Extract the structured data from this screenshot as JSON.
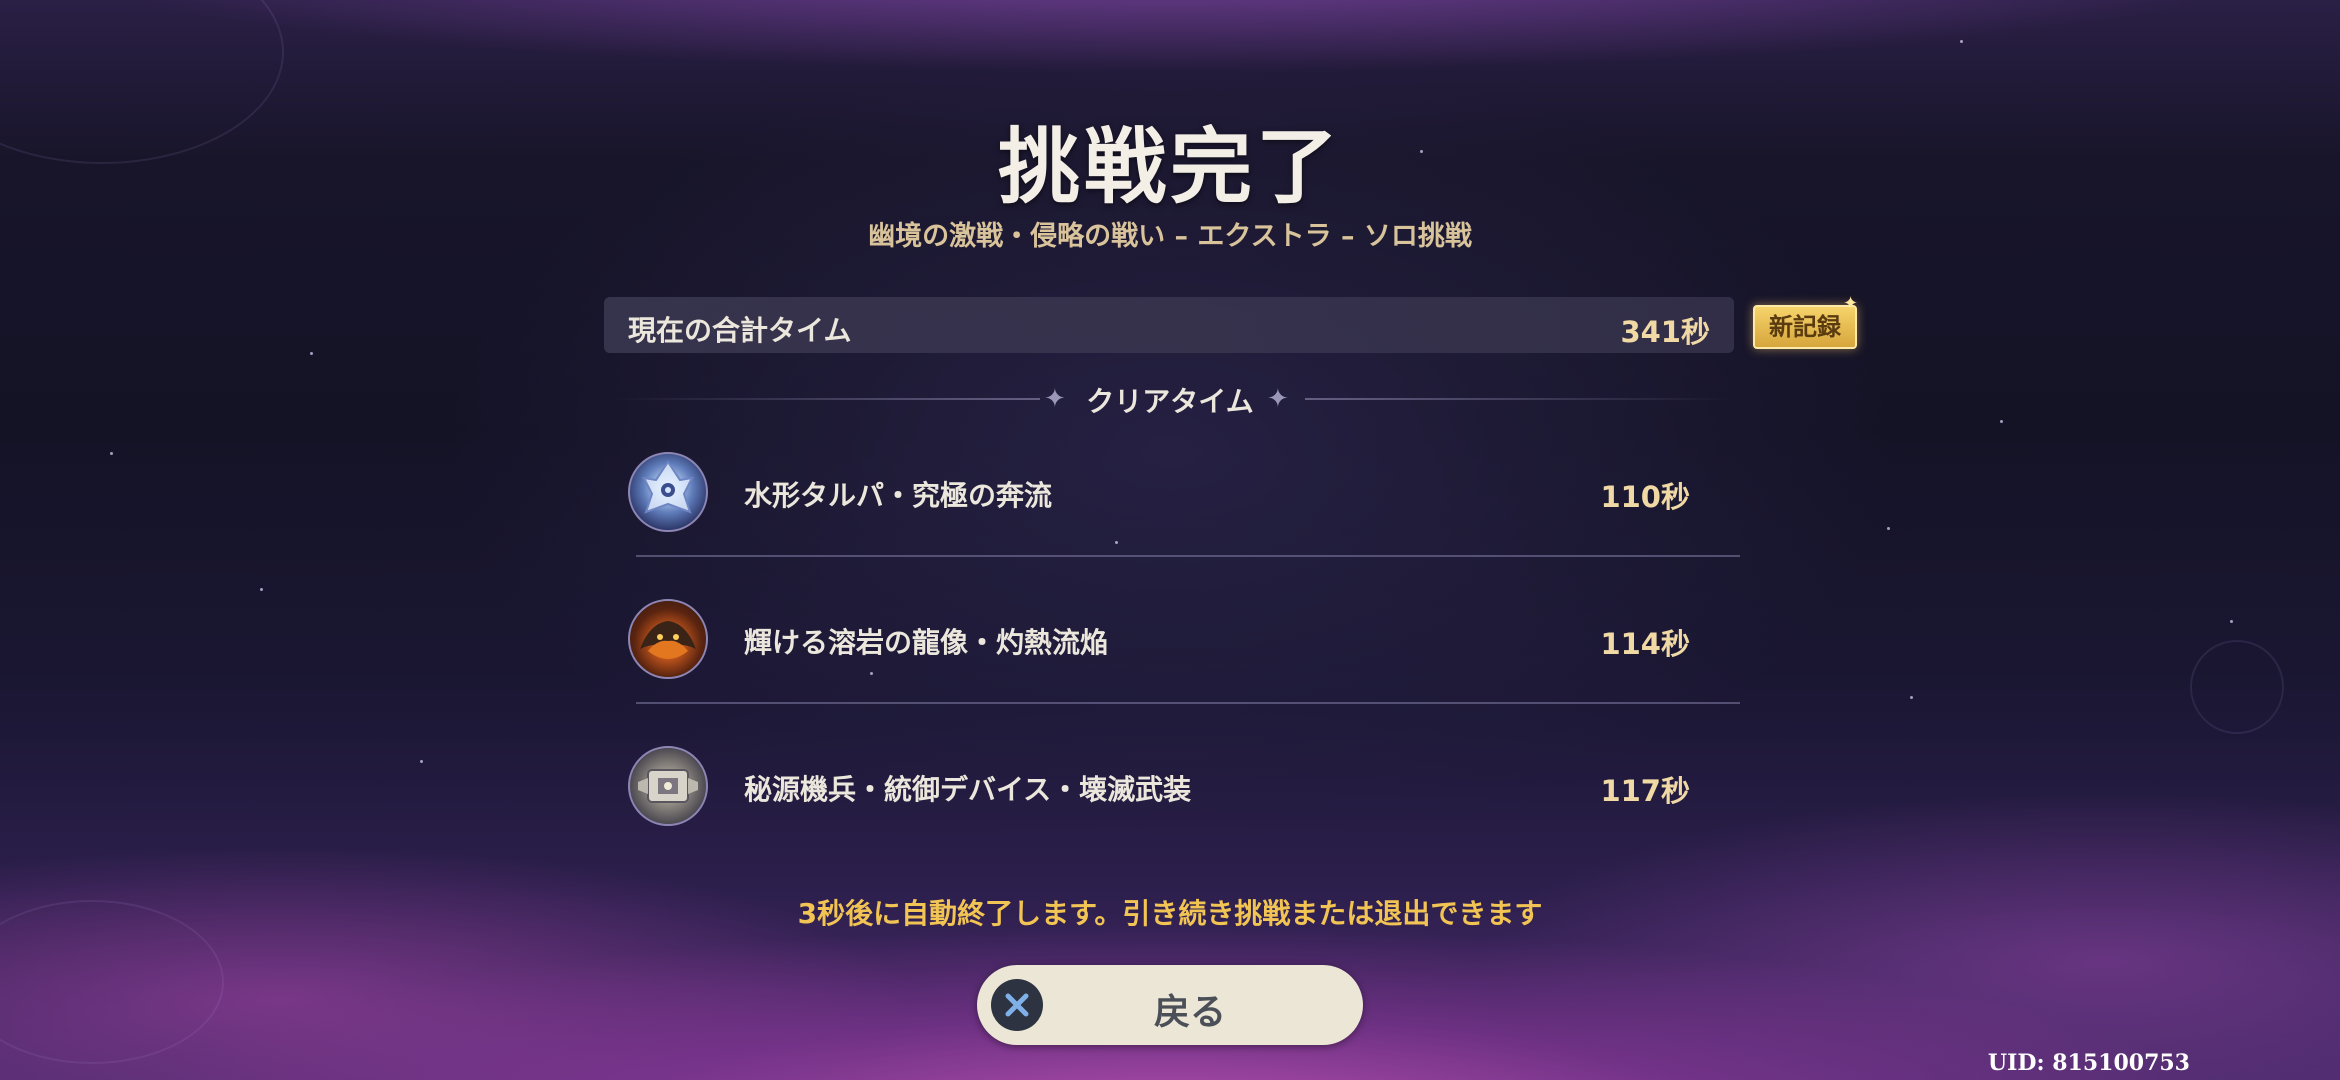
{
  "header": {
    "title": "挑戦完了",
    "subtitle": "幽境の激戦・侵略の戦い – エクストラ – ソロ挑戦"
  },
  "total": {
    "label": "現在の合計タイム",
    "value": "341秒",
    "badge": "新記録"
  },
  "section": {
    "label": "クリアタイム"
  },
  "bosses": [
    {
      "name": "水形タルパ・究極の奔流",
      "time": "110秒",
      "icon": "hydro-tulpa-portrait"
    },
    {
      "name": "輝ける溶岩の龍像・灼熱流焔",
      "time": "114秒",
      "icon": "lava-dragon-statue-portrait"
    },
    {
      "name": "秘源機兵・統御デバイス・壊滅武装",
      "time": "117秒",
      "icon": "secret-source-automaton-portrait"
    }
  ],
  "notice": "3秒後に自動終了します。引き続き挑戦または退出できます",
  "back_button": {
    "label": "戻る",
    "icon": "cross-icon"
  },
  "uid": "UID: 815100753",
  "colors": {
    "gold_text": "#f0d9a4",
    "notice_text": "#f2c453",
    "badge_gold": "#f6d36b",
    "button_bg": "#ece6d6"
  }
}
